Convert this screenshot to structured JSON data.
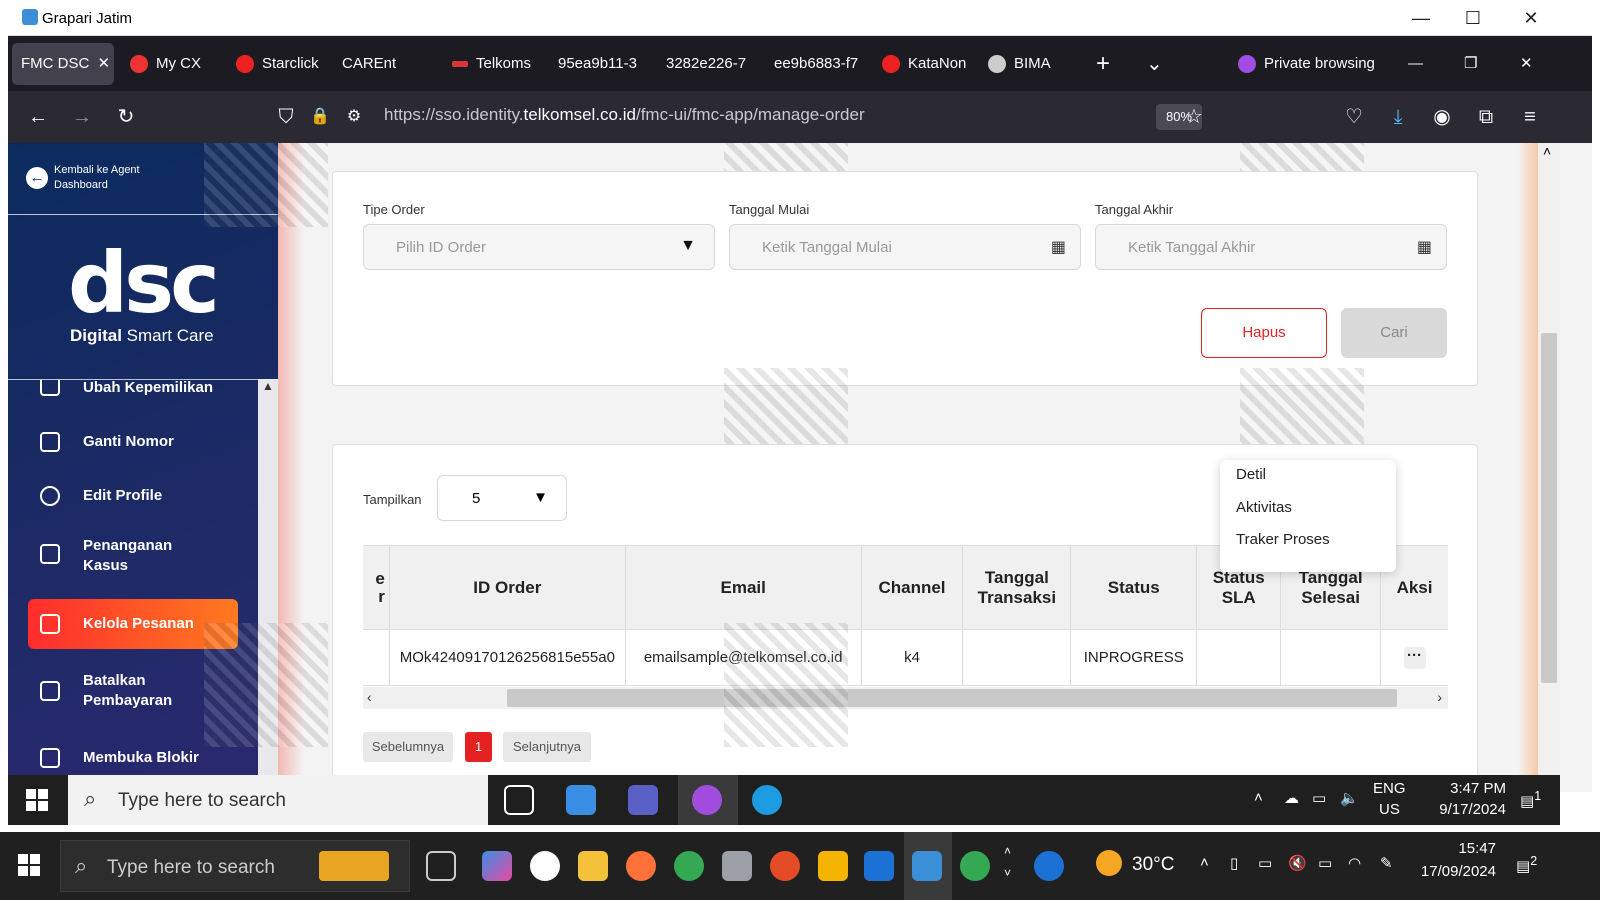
{
  "outer_window": {
    "title": "Grapari Jatim",
    "minimize": "—",
    "maximize": "☐",
    "close": "✕"
  },
  "browser": {
    "tabs": [
      {
        "label": "FMC DSC",
        "active": true,
        "close": "✕"
      },
      {
        "label": "My CX"
      },
      {
        "label": "Starclick"
      },
      {
        "label": "CAREnt"
      },
      {
        "label": "Telkoms"
      },
      {
        "label": "95ea9b11-3"
      },
      {
        "label": "3282e226-7"
      },
      {
        "label": "ee9b6883-f7"
      },
      {
        "label": "KataNon"
      },
      {
        "label": "BIMA"
      }
    ],
    "new_tab": "+",
    "list_tabs": "⌄",
    "private_label": "Private browsing",
    "url_prefix": "https://sso.identity.",
    "url_domain": "telkomsel.co.id",
    "url_path": "/fmc-ui/fmc-app/manage-order",
    "zoom": "80%"
  },
  "sidebar": {
    "back_label": "Kembali ke Agent Dashboard",
    "logo": "dsc",
    "logo_sub_bold": "Digital",
    "logo_sub_rest": " Smart Care",
    "items": [
      {
        "label": "Ubah Kepemilikan"
      },
      {
        "label": "Ganti Nomor"
      },
      {
        "label": "Edit Profile"
      },
      {
        "label": "Penanganan Kasus"
      },
      {
        "label": "Kelola Pesanan",
        "active": true
      },
      {
        "label": "Batalkan Pembayaran"
      },
      {
        "label": "Membuka Blokir"
      }
    ]
  },
  "filter": {
    "tipe_order_label": "Tipe Order",
    "tipe_order_placeholder": "Pilih ID Order",
    "tanggal_mulai_label": "Tanggal Mulai",
    "tanggal_mulai_placeholder": "Ketik Tanggal Mulai",
    "tanggal_akhir_label": "Tanggal Akhir",
    "tanggal_akhir_placeholder": "Ketik Tanggal Akhir",
    "hapus": "Hapus",
    "cari": "Cari"
  },
  "table_section": {
    "tampilkan_label": "Tampilkan",
    "page_size": "5",
    "partial_header": "e\nr",
    "headers": [
      "ID Order",
      "Email",
      "Channel",
      "Tanggal Transaksi",
      "Status",
      "Status SLA",
      "Tanggal Selesai",
      "Aksi"
    ],
    "rows": [
      {
        "id_order": "MOk42409170126256815e55a0",
        "email": "emailsample@telkomsel.co.id",
        "channel": "k4",
        "tanggal_transaksi": "",
        "status": "INPROGRESS",
        "status_sla": "",
        "tanggal_selesai": "",
        "aksi": "···"
      }
    ],
    "pagination": {
      "prev": "Sebelumnya",
      "current": "1",
      "next": "Selanjutnya"
    }
  },
  "action_menu": [
    "Detil",
    "Aktivitas",
    "Traker Proses"
  ],
  "remote_taskbar": {
    "search": "Type here to search",
    "lang": "ENG",
    "region": "US",
    "time": "3:47 PM",
    "date": "9/17/2024",
    "notif": "1"
  },
  "local_taskbar": {
    "search": "Type here to search",
    "weather": "30°C",
    "time": "15:47",
    "date": "17/09/2024",
    "notif": "2"
  }
}
